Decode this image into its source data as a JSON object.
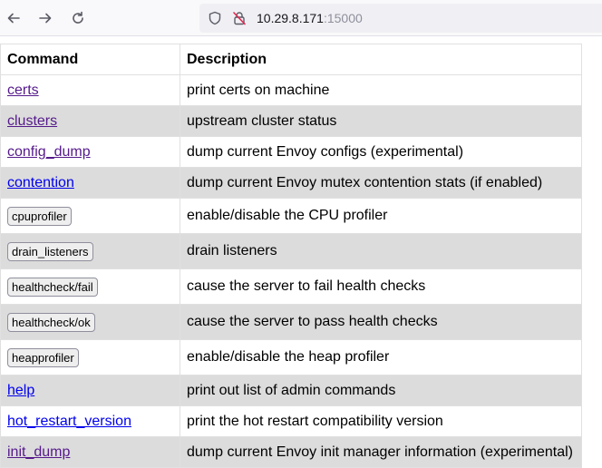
{
  "browser": {
    "url_host": "10.29.8.171",
    "url_port": ":15000"
  },
  "table": {
    "headers": [
      "Command",
      "Description"
    ],
    "rows": [
      {
        "command": "certs",
        "kind": "link",
        "visited": true,
        "description": "print certs on machine"
      },
      {
        "command": "clusters",
        "kind": "link",
        "visited": true,
        "description": "upstream cluster status"
      },
      {
        "command": "config_dump",
        "kind": "link",
        "visited": true,
        "description": "dump current Envoy configs (experimental)"
      },
      {
        "command": "contention",
        "kind": "link",
        "visited": false,
        "description": "dump current Envoy mutex contention stats (if enabled)"
      },
      {
        "command": "cpuprofiler",
        "kind": "button",
        "description": "enable/disable the CPU profiler"
      },
      {
        "command": "drain_listeners",
        "kind": "button",
        "description": "drain listeners"
      },
      {
        "command": "healthcheck/fail",
        "kind": "button",
        "description": "cause the server to fail health checks"
      },
      {
        "command": "healthcheck/ok",
        "kind": "button",
        "description": "cause the server to pass health checks"
      },
      {
        "command": "heapprofiler",
        "kind": "button",
        "description": "enable/disable the heap profiler"
      },
      {
        "command": "help",
        "kind": "link",
        "visited": false,
        "description": "print out list of admin commands"
      },
      {
        "command": "hot_restart_version",
        "kind": "link",
        "visited": false,
        "description": "print the hot restart compatibility version"
      },
      {
        "command": "init_dump",
        "kind": "link",
        "visited": true,
        "description": "dump current Envoy init manager information (experimental)"
      }
    ]
  },
  "colors": {
    "visited_link": "#551a8b",
    "unvisited_link": "#0000ee",
    "shaded_row": "#dcdcdc"
  }
}
